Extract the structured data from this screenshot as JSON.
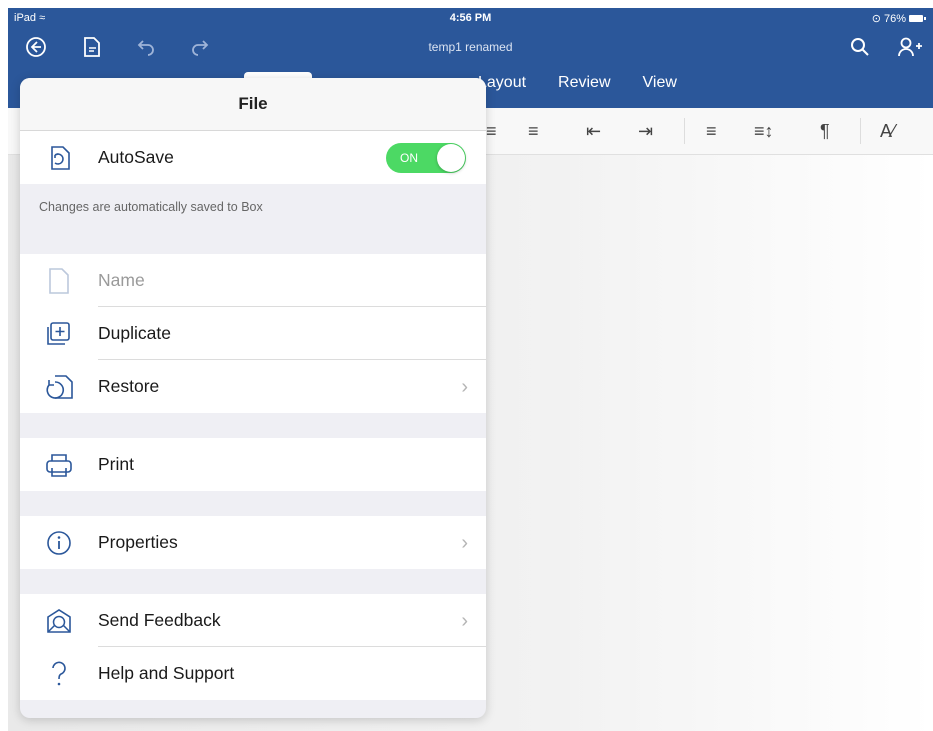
{
  "status_bar": {
    "device": "iPad",
    "time": "4:56 PM",
    "battery": "76%"
  },
  "document": {
    "title": "temp1 renamed"
  },
  "ribbon_tabs": [
    "Layout",
    "Review",
    "View"
  ],
  "file_panel": {
    "title": "File",
    "autosave": {
      "label": "AutoSave",
      "toggle_label": "ON",
      "note": "Changes are automatically saved to Box"
    },
    "items": {
      "name": "Name",
      "duplicate": "Duplicate",
      "restore": "Restore",
      "print": "Print",
      "properties": "Properties",
      "send_feedback": "Send Feedback",
      "help_support": "Help and Support"
    }
  },
  "colors": {
    "brand": "#2b579a",
    "toggle_on": "#4cd964"
  }
}
